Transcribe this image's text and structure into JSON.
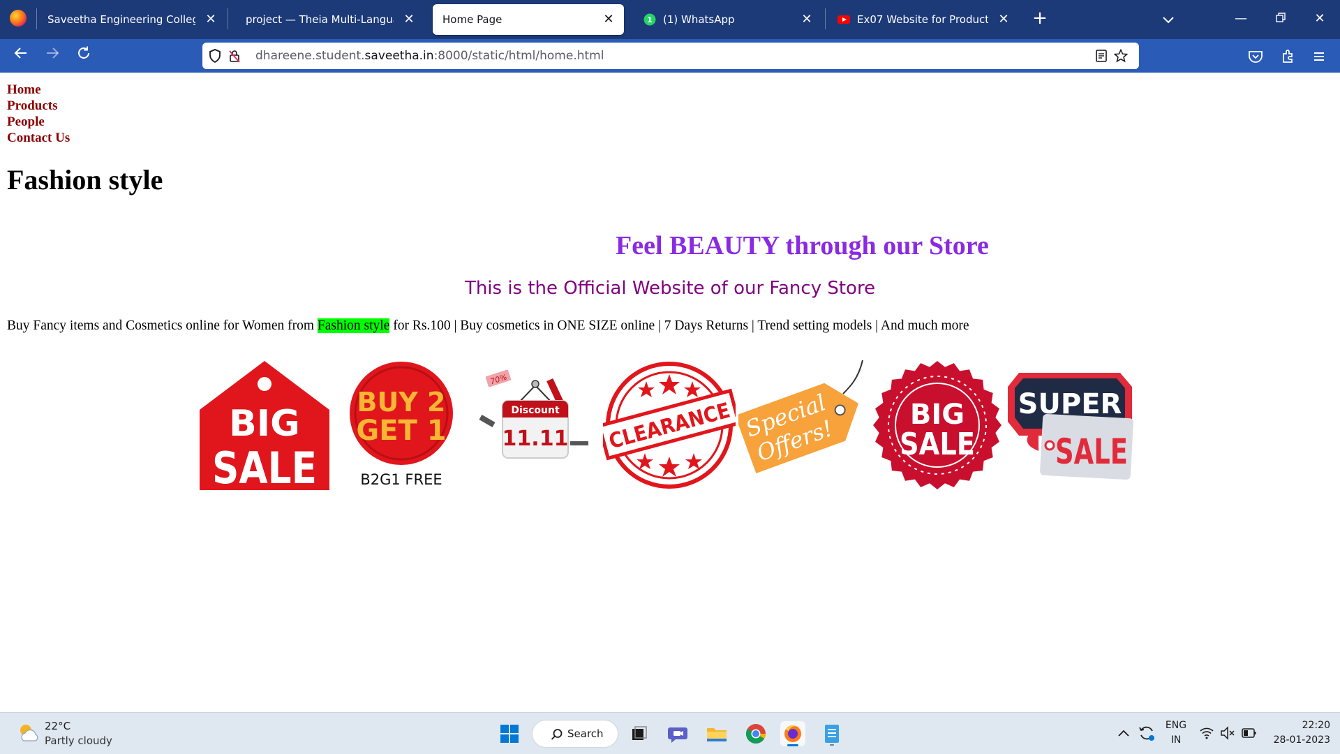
{
  "browser": {
    "tabs": [
      {
        "label": "Saveetha Engineering College",
        "active": false
      },
      {
        "label": "project — Theia Multi-Language Ex",
        "active": false
      },
      {
        "label": "Home Page",
        "active": true
      },
      {
        "label": "(1) WhatsApp",
        "active": false
      },
      {
        "label": "Ex07 Website for Product Devel",
        "active": false
      }
    ],
    "url_host_prefix": "dhareene.student.",
    "url_host": "saveetha.in",
    "url_rest": ":8000/static/html/home.html"
  },
  "page": {
    "menu": [
      "Home",
      "Products",
      "People",
      "Contact Us"
    ],
    "heading": "Fashion style",
    "tagline": "Feel BEAUTY through our Store",
    "subline": "This is the Official Website of our Fancy Store",
    "para_before": "Buy Fancy items and Cosmetics online for Women from ",
    "para_highlight": "Fashion style",
    "para_after": " for Rs.100 | Buy cosmetics in ONE SIZE online | 7 Days Returns | Trend setting models | And much more",
    "badges": [
      {
        "line1": "BIG",
        "line2": "SALE"
      },
      {
        "line1": "BUY 2",
        "line2": "GET 1",
        "caption": "B2G1 FREE"
      },
      {
        "label": "Discount",
        "date": "11.11",
        "tag": "70%"
      },
      {
        "text": "CLEARANCE"
      },
      {
        "line1": "Special",
        "line2": "Offers!"
      },
      {
        "line1": "BIG",
        "line2": "SALE"
      },
      {
        "line1": "SUPER",
        "line2": "SALE"
      }
    ]
  },
  "taskbar": {
    "temperature": "22°C",
    "weather": "Partly cloudy",
    "search_label": "Search",
    "lang_top": "ENG",
    "lang_bottom": "IN",
    "time": "22:20",
    "date": "28-01-2023"
  },
  "colors": {
    "tabbar": "#1c3a78",
    "navbar": "#2a5bb7",
    "menu_link": "#8b0000",
    "tagline": "#8a2be2",
    "subline": "#800080",
    "highlight": "#00ff00",
    "sale_red": "#e1161c"
  }
}
